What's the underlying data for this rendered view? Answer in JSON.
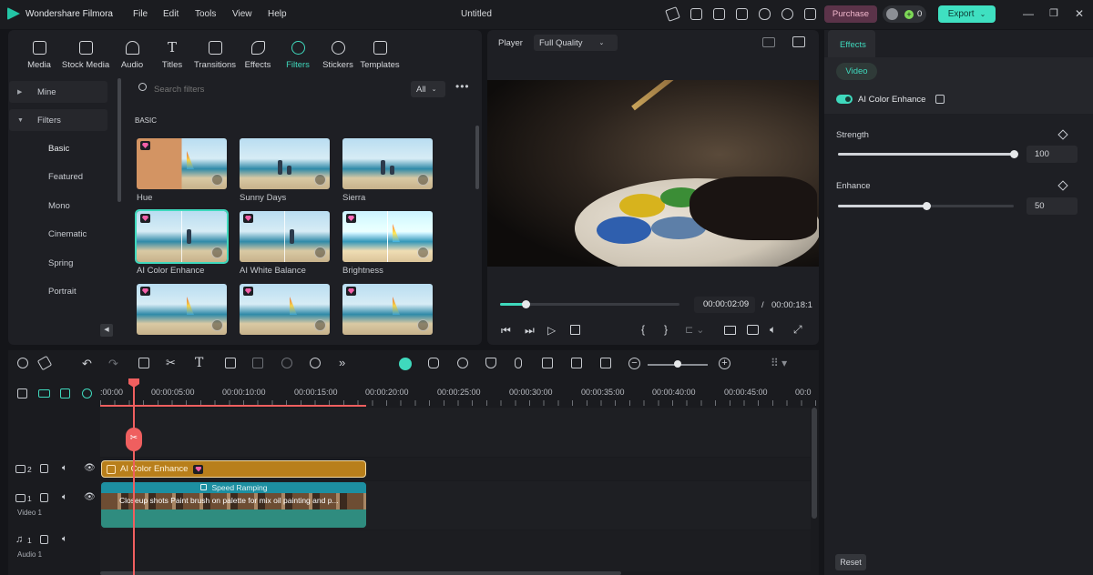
{
  "titlebar": {
    "app_name": "Wondershare Filmora",
    "menu": [
      "File",
      "Edit",
      "Tools",
      "View",
      "Help"
    ],
    "document_title": "Untitled",
    "purchase_label": "Purchase",
    "credits": "0",
    "export_label": "Export"
  },
  "media_tabs": [
    {
      "label": "Media",
      "icon": "media-icon"
    },
    {
      "label": "Stock Media",
      "icon": "stock-media-icon"
    },
    {
      "label": "Audio",
      "icon": "music-note-icon"
    },
    {
      "label": "Titles",
      "icon": "text-t-icon"
    },
    {
      "label": "Transitions",
      "icon": "transitions-icon"
    },
    {
      "label": "Effects",
      "icon": "effects-icon"
    },
    {
      "label": "Filters",
      "icon": "filters-icon",
      "active": true
    },
    {
      "label": "Stickers",
      "icon": "stickers-icon"
    },
    {
      "label": "Templates",
      "icon": "templates-icon"
    }
  ],
  "categories": {
    "mine": "Mine",
    "filters": "Filters",
    "items": [
      "Basic",
      "Featured",
      "Mono",
      "Cinematic",
      "Spring",
      "Portrait"
    ]
  },
  "search": {
    "placeholder": "Search filters",
    "scope": "All"
  },
  "section_title": "BASIC",
  "filters": [
    {
      "label": "Hue",
      "premium": true
    },
    {
      "label": "Sunny Days",
      "premium": false
    },
    {
      "label": "Sierra",
      "premium": false
    },
    {
      "label": "AI Color Enhance",
      "premium": true,
      "selected": true
    },
    {
      "label": "AI White Balance",
      "premium": true
    },
    {
      "label": "Brightness",
      "premium": true
    },
    {
      "label": "",
      "premium": true
    },
    {
      "label": "",
      "premium": true
    },
    {
      "label": "",
      "premium": true
    }
  ],
  "player": {
    "label": "Player",
    "quality": "Full Quality",
    "current_time": "00:00:02:09",
    "separator": "/",
    "total_time": "00:00:18:1",
    "progress": 0.14
  },
  "properties": {
    "tab": "Effects",
    "subtab": "Video",
    "effect_name": "AI Color Enhance",
    "effect_enabled": true,
    "strength_label": "Strength",
    "strength_value": "100",
    "strength_level": 1.0,
    "enhance_label": "Enhance",
    "enhance_value": "50",
    "enhance_level": 0.5,
    "reset_label": "Reset"
  },
  "timeline": {
    "ruler": [
      ":00:00",
      "00:00:05:00",
      "00:00:10:00",
      "00:00:15:00",
      "00:00:20:00",
      "00:00:25:00",
      "00:00:30:00",
      "00:00:35:00",
      "00:00:40:00",
      "00:00:45:00",
      "00:0"
    ],
    "tracks": [
      {
        "id": "2",
        "name": ""
      },
      {
        "id": "1",
        "name": "Video 1"
      },
      {
        "id": "1",
        "name": "Audio 1"
      }
    ],
    "effect_clip": "AI Color Enhance",
    "speed_label": "Speed Ramping",
    "video_clip": "Closeup shots Paint brush on palette for mix oil painting and p..."
  },
  "colors": {
    "accent": "#3fd9bd",
    "export_bg": "#3fe0c1",
    "purchase_bg": "#5b3349",
    "effect_clip": "#b87f1b",
    "playhead": "#ef5f5f"
  }
}
